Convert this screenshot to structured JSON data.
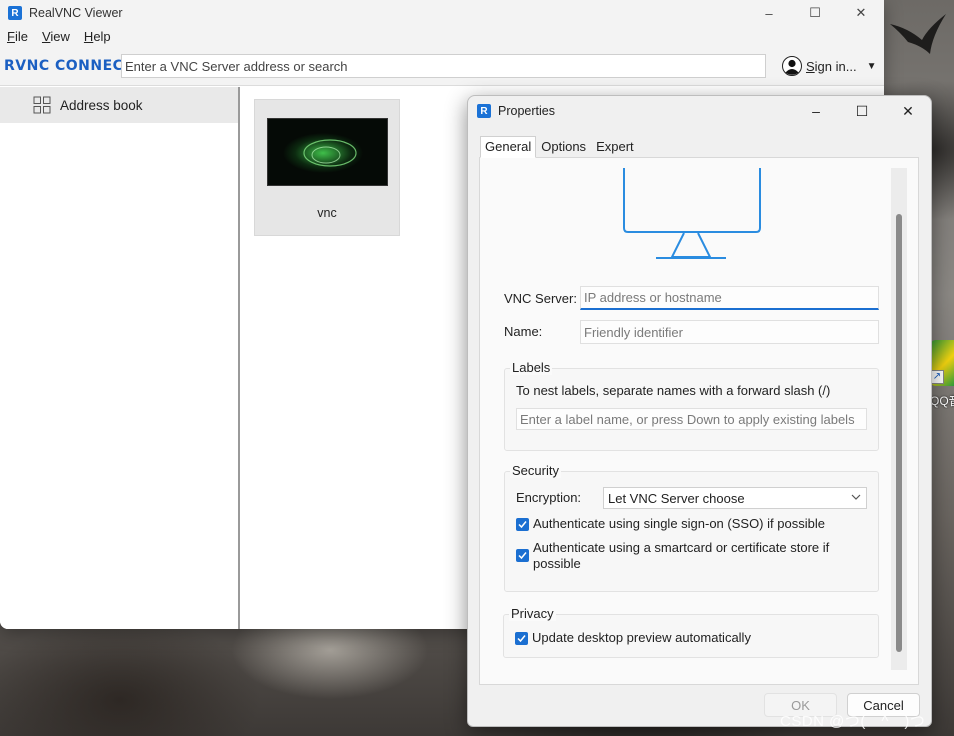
{
  "main_window": {
    "title": "RealVNC Viewer",
    "menu": [
      {
        "key": "F",
        "rest": "ile"
      },
      {
        "key": "V",
        "rest": "iew"
      },
      {
        "key": "H",
        "rest": "elp"
      }
    ],
    "logo_text": "RVNC CONNECT",
    "search_placeholder": "Enter a VNC Server address or search",
    "sign_in": {
      "prefix": "S",
      "rest": "ign in..."
    },
    "sidebar": {
      "item_label": "Address book"
    },
    "tiles": [
      {
        "label": "vnc"
      }
    ],
    "controls": {
      "minimize": "–",
      "maximize": "☐",
      "close": "✕"
    }
  },
  "dialog": {
    "title": "Properties",
    "tabs": [
      "General",
      "Options",
      "Expert"
    ],
    "vnc_server": {
      "label": "VNC Server:",
      "placeholder": "IP address or hostname"
    },
    "name": {
      "label": "Name:",
      "placeholder": "Friendly identifier"
    },
    "labels_group": {
      "title": "Labels",
      "note": "To nest labels, separate names with a forward slash (/)",
      "placeholder": "Enter a label name, or press Down to apply existing labels"
    },
    "security_group": {
      "title": "Security",
      "encryption_label": "Encryption:",
      "encryption_value": "Let VNC Server choose",
      "sso_label": "Authenticate using single sign-on (SSO) if possible",
      "sso_checked": true,
      "smartcard_label": "Authenticate using a smartcard or certificate store if possible",
      "smartcard_checked": true
    },
    "privacy_group": {
      "title": "Privacy",
      "preview_label": "Update desktop preview automatically",
      "preview_checked": true
    },
    "buttons": {
      "ok": "OK",
      "cancel": "Cancel"
    }
  },
  "desktop": {
    "qq_label": "QQ音",
    "watermark": "CSDN @つ(￣^￣)つ"
  },
  "colors": {
    "accent": "#1b6fd1",
    "brand": "#1b5fc2"
  }
}
